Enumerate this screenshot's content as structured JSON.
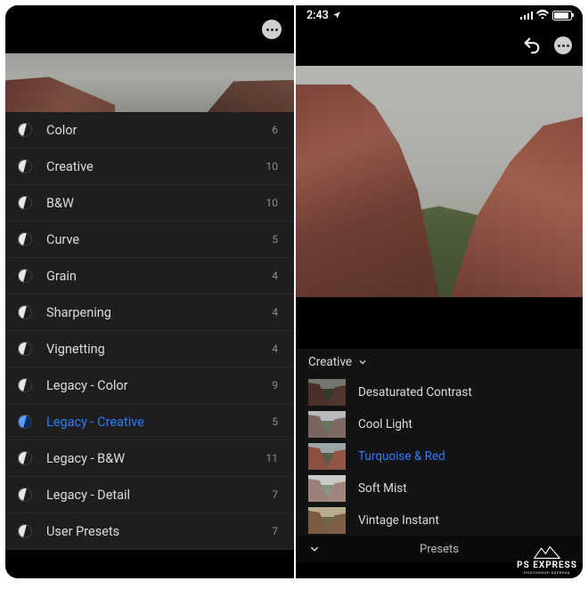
{
  "left": {
    "categories": [
      {
        "label": "Color",
        "count": "6",
        "selected": false
      },
      {
        "label": "Creative",
        "count": "10",
        "selected": false
      },
      {
        "label": "B&W",
        "count": "10",
        "selected": false
      },
      {
        "label": "Curve",
        "count": "5",
        "selected": false
      },
      {
        "label": "Grain",
        "count": "4",
        "selected": false
      },
      {
        "label": "Sharpening",
        "count": "4",
        "selected": false
      },
      {
        "label": "Vignetting",
        "count": "4",
        "selected": false
      },
      {
        "label": "Legacy - Color",
        "count": "9",
        "selected": false
      },
      {
        "label": "Legacy - Creative",
        "count": "5",
        "selected": true
      },
      {
        "label": "Legacy - B&W",
        "count": "11",
        "selected": false
      },
      {
        "label": "Legacy - Detail",
        "count": "7",
        "selected": false
      },
      {
        "label": "User Presets",
        "count": "7",
        "selected": false
      }
    ]
  },
  "right": {
    "status": {
      "time": "2:43"
    },
    "dropdown_label": "Creative",
    "presets": [
      {
        "label": "Desaturated Contrast",
        "variant": "v0",
        "selected": false
      },
      {
        "label": "Cool Light",
        "variant": "v1",
        "selected": false
      },
      {
        "label": "Turquoise & Red",
        "variant": "v2",
        "selected": true
      },
      {
        "label": "Soft Mist",
        "variant": "v3",
        "selected": false
      },
      {
        "label": "Vintage Instant",
        "variant": "v4",
        "selected": false
      }
    ],
    "bottom_label": "Presets"
  },
  "watermark": {
    "line1": "PS EXPRESS",
    "line2": "PHOTOSHOP EXPRESS"
  }
}
